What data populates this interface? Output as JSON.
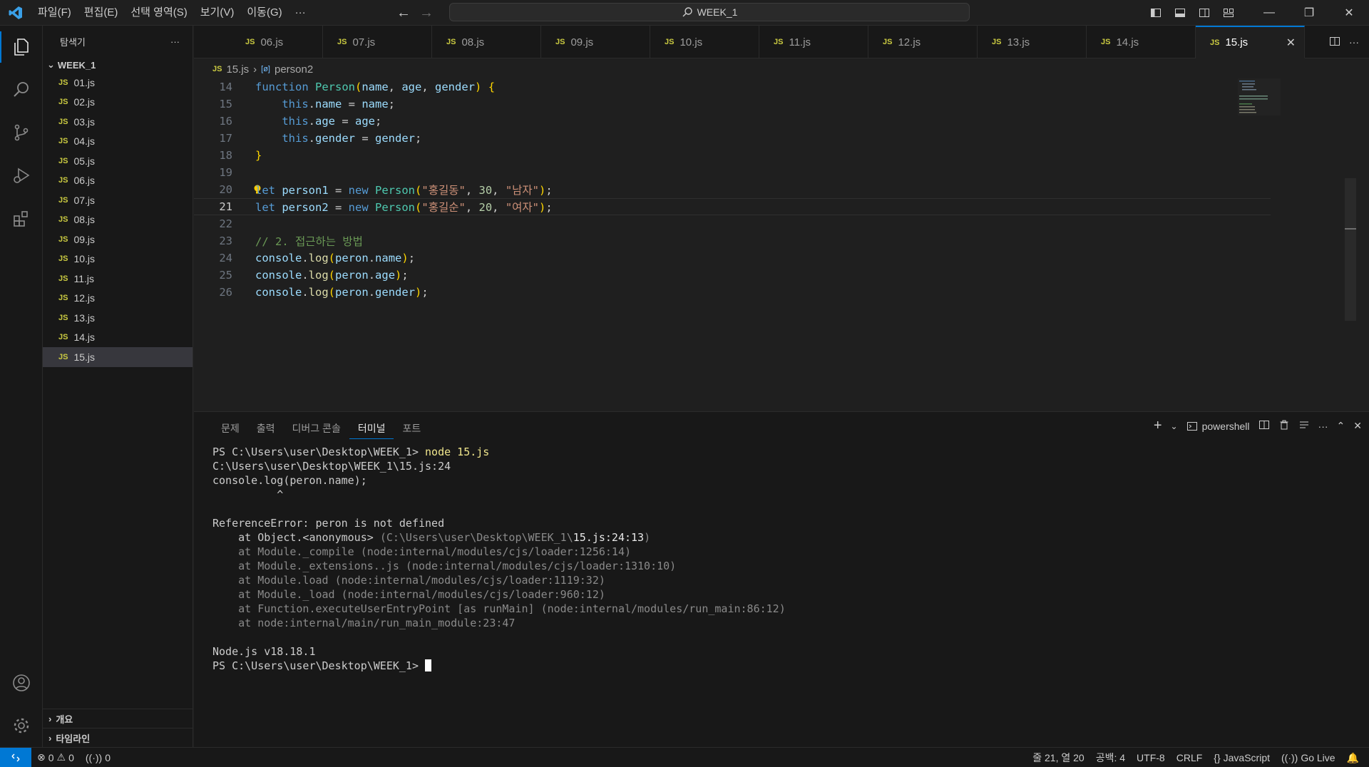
{
  "titlebar": {
    "menus": [
      "파일(F)",
      "편집(E)",
      "선택 영역(S)",
      "보기(V)",
      "이동(G)",
      "···"
    ],
    "search": "WEEK_1"
  },
  "sidebar": {
    "title": "탐색기",
    "folder": "WEEK_1",
    "files": [
      "01.js",
      "02.js",
      "03.js",
      "04.js",
      "05.js",
      "06.js",
      "07.js",
      "08.js",
      "09.js",
      "10.js",
      "11.js",
      "12.js",
      "13.js",
      "14.js",
      "15.js"
    ],
    "active_file": "15.js",
    "sections": [
      "개요",
      "타임라인"
    ]
  },
  "tabs": {
    "items": [
      "06.js",
      "07.js",
      "08.js",
      "09.js",
      "10.js",
      "11.js",
      "12.js",
      "13.js",
      "14.js",
      "15.js"
    ],
    "active": "15.js",
    "badge": "JS"
  },
  "breadcrumb": {
    "file": "15.js",
    "symbol": "person2"
  },
  "editor": {
    "line_numbers": [
      "14",
      "15",
      "16",
      "17",
      "18",
      "19",
      "20",
      "21",
      "22",
      "23",
      "24",
      "25",
      "26"
    ],
    "current_line": "21"
  },
  "panel": {
    "tabs": [
      "문제",
      "출력",
      "디버그 콘솔",
      "터미널",
      "포트"
    ],
    "active_tab": "터미널",
    "shell": "powershell",
    "terminal_lines": [
      {
        "text": "PS C:\\Users\\user\\Desktop\\WEEK_1> ",
        "cmd": "node 15.js"
      },
      {
        "text": "C:\\Users\\user\\Desktop\\WEEK_1\\15.js:24"
      },
      {
        "text": "console.log(peron.name);"
      },
      {
        "text": "          ^"
      },
      {
        "text": ""
      },
      {
        "text": "ReferenceError: peron is not defined"
      },
      {
        "text": "    at Object.<anonymous> ",
        "dim": "(C:\\Users\\user\\Desktop\\WEEK_1\\",
        "bright": "15.js:24:13",
        "dim2": ")"
      },
      {
        "text": "    at Module._compile (node:internal/modules/cjs/loader:1256:14)",
        "style": "dim"
      },
      {
        "text": "    at Module._extensions..js (node:internal/modules/cjs/loader:1310:10)",
        "style": "dim"
      },
      {
        "text": "    at Module.load (node:internal/modules/cjs/loader:1119:32)",
        "style": "dim"
      },
      {
        "text": "    at Module._load (node:internal/modules/cjs/loader:960:12)",
        "style": "dim"
      },
      {
        "text": "    at Function.executeUserEntryPoint [as runMain] (node:internal/modules/run_main:86:12)",
        "style": "dim"
      },
      {
        "text": "    at node:internal/main/run_main_module:23:47",
        "style": "dim"
      },
      {
        "text": ""
      },
      {
        "text": "Node.js v18.18.1"
      },
      {
        "text": "PS C:\\Users\\user\\Desktop\\WEEK_1> ",
        "cursor": true
      }
    ]
  },
  "statusbar": {
    "errors": "0",
    "warnings": "0",
    "ports": "0",
    "position": "줄 21, 열 20",
    "spaces": "공백: 4",
    "encoding": "UTF-8",
    "eol": "CRLF",
    "language": "JavaScript",
    "golive": "Go Live"
  },
  "colors": {
    "accent": "#0078d4",
    "js_badge": "#cbcb41",
    "background": "#1f1f1f"
  }
}
